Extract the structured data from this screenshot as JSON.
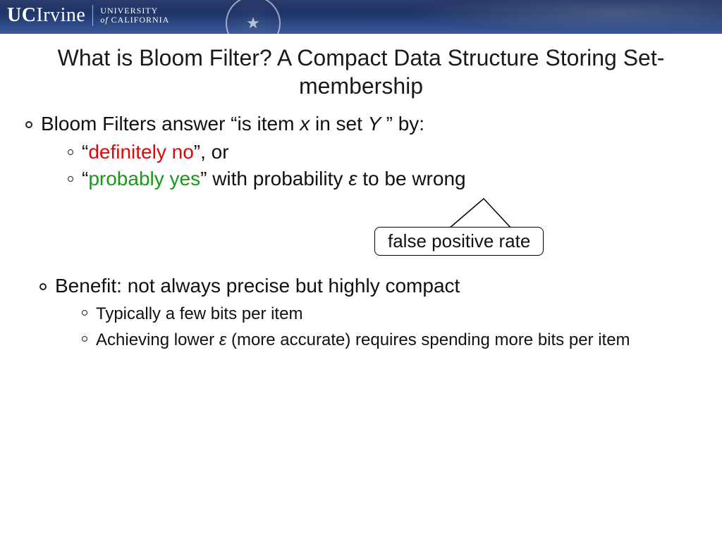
{
  "header": {
    "logo_main_a": "UC",
    "logo_main_b": "Irvine",
    "logo_sub_line1": "UNIVERSITY",
    "logo_sub_line2_a": "of ",
    "logo_sub_line2_b": "CALIFORNIA"
  },
  "title": "What is Bloom Filter? A Compact Data Structure Storing Set-membership",
  "bullet1": {
    "prefix": "Bloom Filters answer “is item ",
    "x": "x",
    "mid": " in set ",
    "y": "Y ",
    "suffix": "” by:"
  },
  "sub1a": {
    "q1": "“",
    "red": "definitely no",
    "q2": "”, or"
  },
  "sub1b": {
    "q1": "“",
    "green": "probably yes",
    "q2": "” with probability ",
    "eps": "ε",
    "tail": " to be wrong"
  },
  "callout": "false positive rate",
  "bullet2": "Benefit: not always precise but highly compact",
  "sub2a": "Typically a few bits per item",
  "sub2b": {
    "a": "Achieving lower ",
    "eps": "ε",
    "b": " (more accurate) requires spending more bits per item"
  }
}
